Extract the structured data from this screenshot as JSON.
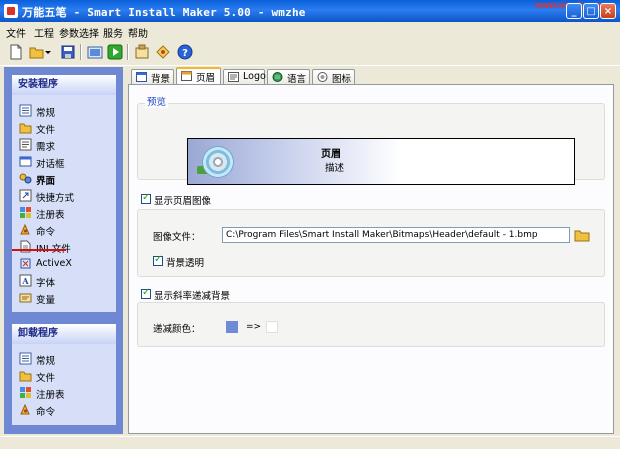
{
  "window": {
    "title": "万能五笔 - Smart Install Maker 5.00 - wmzhe",
    "watermark": "www.wmzhe.com",
    "minimize": "_",
    "maximize": "□",
    "close": "×"
  },
  "menu": [
    "文件",
    "工程",
    "参数选择",
    "服务",
    "帮助"
  ],
  "toolbar": [
    "new-file-icon",
    "open-folder-icon",
    "dropdown-arrow-icon",
    "save-icon",
    "build-icon",
    "run-icon",
    "settings-icon",
    "wizard-icon",
    "help-icon"
  ],
  "install_group": {
    "header": "安装程序",
    "items": [
      {
        "label": "常规",
        "icon": "general-icon"
      },
      {
        "label": "文件",
        "icon": "files-icon"
      },
      {
        "label": "需求",
        "icon": "requirements-icon"
      },
      {
        "label": "对话框",
        "icon": "dialogs-icon"
      },
      {
        "label": "界面",
        "icon": "interface-icon"
      },
      {
        "label": "快捷方式",
        "icon": "shortcuts-icon"
      },
      {
        "label": "注册表",
        "icon": "registry-icon"
      },
      {
        "label": "命令",
        "icon": "commands-icon"
      },
      {
        "label": "INI 文件",
        "icon": "ini-file-icon"
      },
      {
        "label": "ActiveX",
        "icon": "activex-icon"
      },
      {
        "label": "字体",
        "icon": "fonts-icon"
      },
      {
        "label": "变量",
        "icon": "variables-icon"
      }
    ],
    "selected": "界面"
  },
  "uninstall_group": {
    "header": "卸载程序",
    "items": [
      {
        "label": "常规",
        "icon": "general-icon"
      },
      {
        "label": "文件",
        "icon": "files-icon"
      },
      {
        "label": "注册表",
        "icon": "registry-icon"
      },
      {
        "label": "命令",
        "icon": "commands-icon"
      }
    ]
  },
  "tabs": [
    {
      "label": "背景",
      "icon": "background-tab-icon"
    },
    {
      "label": "页眉",
      "icon": "header-tab-icon",
      "active": true
    },
    {
      "label": "Logo",
      "icon": "logo-tab-icon"
    },
    {
      "label": "语言",
      "icon": "language-tab-icon"
    },
    {
      "label": "图标",
      "icon": "icon-tab-icon"
    }
  ],
  "preview": {
    "legend": "预览",
    "header_title": "页眉",
    "header_desc": "描述"
  },
  "header_image": {
    "checkbox_label": "显示页眉图像",
    "checked": true,
    "file_label": "图像文件：",
    "file_value": "C:\\Program Files\\Smart Install Maker\\Bitmaps\\Header\\default - 1.bmp",
    "transparent_label": "背景透明",
    "transparent_checked": true
  },
  "gradient": {
    "checkbox_label": "显示斜率递减背景",
    "checked": true,
    "color_label": "递减颜色：",
    "arrow": "=>",
    "color_from": "#6f8bd8",
    "color_to": "#ffffff"
  }
}
